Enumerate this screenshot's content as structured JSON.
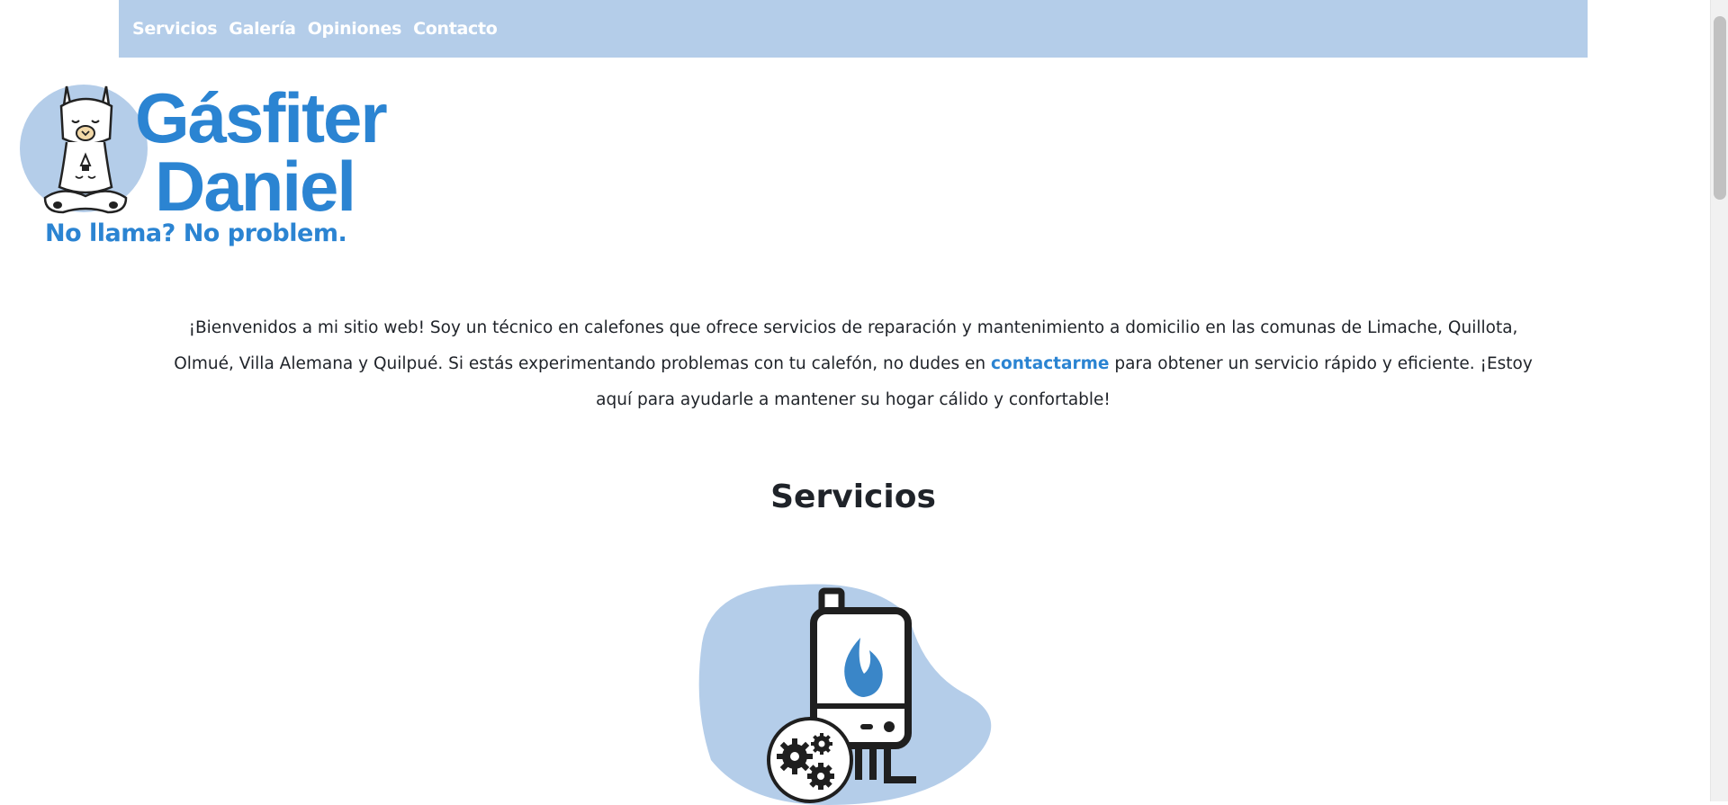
{
  "nav": {
    "items": [
      {
        "label": "Servicios"
      },
      {
        "label": "Galería"
      },
      {
        "label": "Opiniones"
      },
      {
        "label": "Contacto"
      }
    ]
  },
  "logo": {
    "name_line1": "Gásfiter",
    "name_line2": "Daniel",
    "tagline": "No llama? No problem."
  },
  "intro": {
    "text_before": "¡Bienvenidos a mi sitio web! Soy un técnico en calefones que ofrece servicios de reparación y mantenimiento a domicilio en las comunas de Limache, Quillota, Olmué, Villa Alemana y Quilpué. Si estás experimentando problemas con tu calefón, no dudes en ",
    "link": "contactarme",
    "text_after": " para obtener un servicio rápido y eficiente. ¡Estoy aquí para ayudarle a mantener su hogar cálido y confortable!"
  },
  "services": {
    "title": "Servicios"
  },
  "colors": {
    "nav_bg": "#b4cde9",
    "brand_blue": "#2b84d2",
    "text": "#1f2329"
  },
  "icons": [
    "llama-mascot-icon",
    "water-heater-icon",
    "flame-icon",
    "gears-icon"
  ]
}
